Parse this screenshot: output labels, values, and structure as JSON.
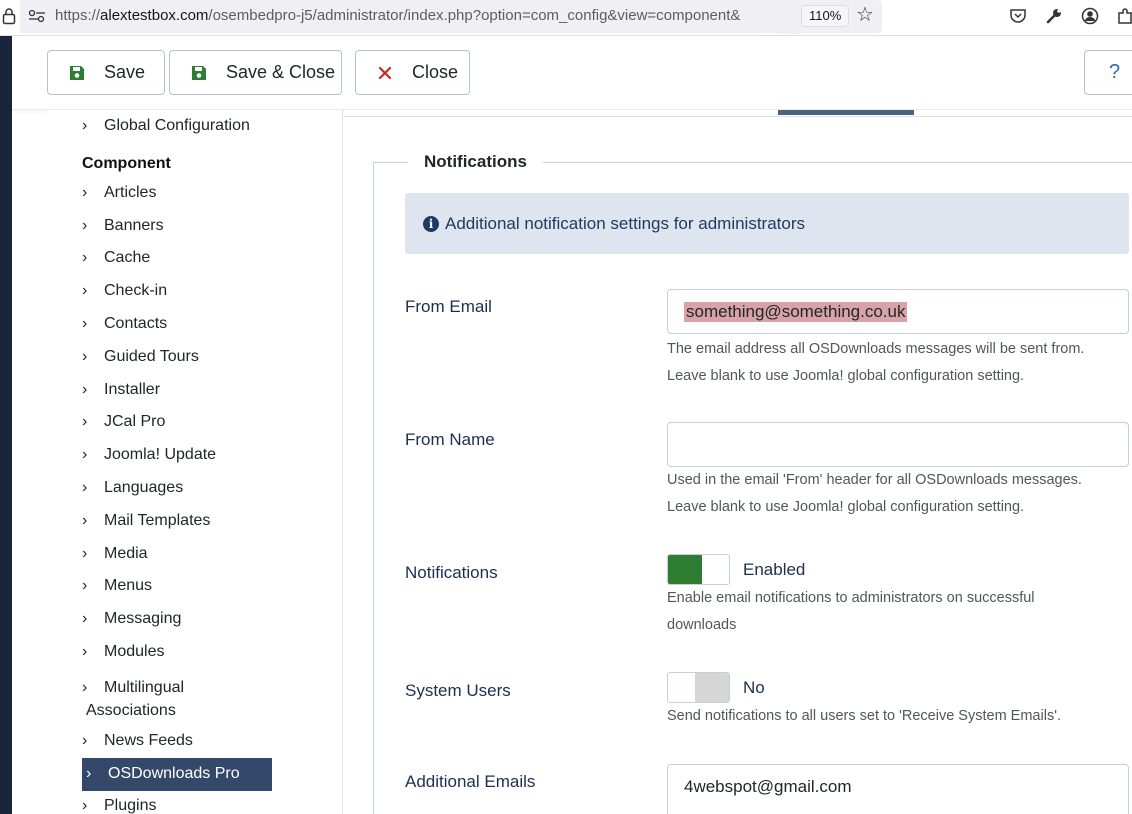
{
  "browser": {
    "url_prefix": "https://",
    "url_host": "alextestbox.com",
    "url_path": "/osembedpro-j5/administrator/index.php?option=com_config&view=component&",
    "zoom": "110%"
  },
  "toolbar": {
    "save_label": "Save",
    "save_close_label": "Save & Close",
    "close_label": "Close",
    "help_label": "?"
  },
  "sidebar": {
    "global_config": "Global Configuration",
    "heading": "Component",
    "items": [
      {
        "label": "Articles"
      },
      {
        "label": "Banners"
      },
      {
        "label": "Cache"
      },
      {
        "label": "Check-in"
      },
      {
        "label": "Contacts"
      },
      {
        "label": "Guided Tours"
      },
      {
        "label": "Installer"
      },
      {
        "label": "JCal Pro"
      },
      {
        "label": "Joomla! Update"
      },
      {
        "label": "Languages"
      },
      {
        "label": "Mail Templates"
      },
      {
        "label": "Media"
      },
      {
        "label": "Menus"
      },
      {
        "label": "Messaging"
      },
      {
        "label": "Modules"
      },
      {
        "label": "Multilingual",
        "label2": "Associations"
      },
      {
        "label": "News Feeds"
      },
      {
        "label": "OSDownloads Pro",
        "active": true
      },
      {
        "label": "Plugins"
      }
    ]
  },
  "main": {
    "fieldset_legend": "Notifications",
    "alert_text": "Additional notification settings for administrators",
    "fields": {
      "from_email": {
        "label": "From Email",
        "value": "something@something.co.uk",
        "desc1": "The email address all OSDownloads messages will be sent from.",
        "desc2": "Leave blank to use Joomla! global configuration setting."
      },
      "from_name": {
        "label": "From Name",
        "value": "",
        "desc1": "Used in the email 'From' header for all OSDownloads messages.",
        "desc2": "Leave blank to use Joomla! global configuration setting."
      },
      "notifications": {
        "label": "Notifications",
        "state": "Enabled",
        "desc1": "Enable email notifications to administrators on successful",
        "desc2": "downloads"
      },
      "system_users": {
        "label": "System Users",
        "state": "No",
        "desc1": "Send notifications to all users set to 'Receive System Emails'."
      },
      "additional_emails": {
        "label": "Additional Emails",
        "value": "4webspot@gmail.com"
      }
    }
  },
  "colors": {
    "sidebar_active_bg": "#34496a",
    "toggle_on": "#2e7d32",
    "alert_bg": "#dfe5ee",
    "save_icon": "#2e7d32",
    "close_icon": "#c62828"
  }
}
